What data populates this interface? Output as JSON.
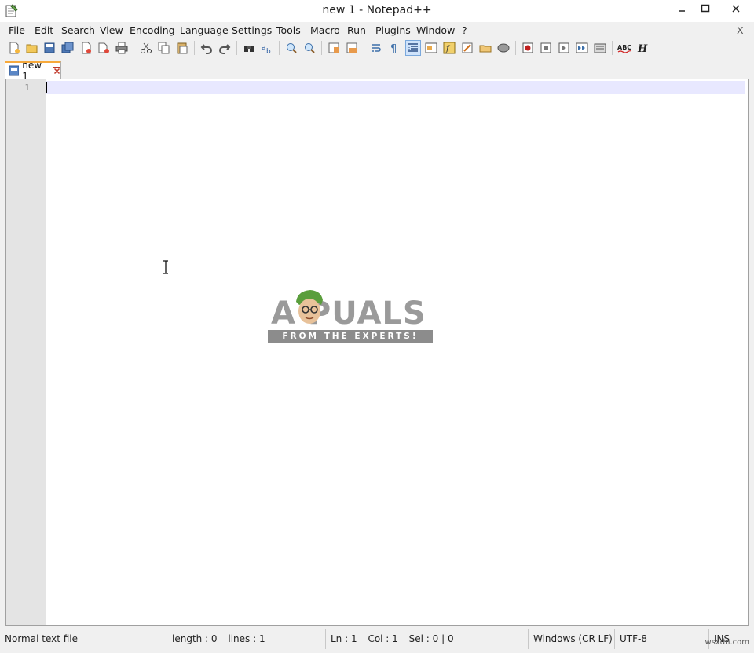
{
  "window": {
    "title": "new 1 - Notepad++"
  },
  "menu": {
    "items": [
      "File",
      "Edit",
      "Search",
      "View",
      "Encoding",
      "Language",
      "Settings",
      "Tools",
      "Macro",
      "Run",
      "Plugins",
      "Window",
      "?"
    ],
    "close_label": "X"
  },
  "toolbar": {
    "icons": [
      "new-file-icon",
      "open-file-icon",
      "save-icon",
      "save-all-icon",
      "close-icon",
      "close-all-icon",
      "print-icon",
      "cut-icon",
      "copy-icon",
      "paste-icon",
      "undo-icon",
      "redo-icon",
      "find-icon",
      "replace-icon",
      "zoom-in-icon",
      "zoom-out-icon",
      "sync-vertical-icon",
      "sync-horizontal-icon",
      "word-wrap-icon",
      "show-all-characters-icon",
      "indent-guide-icon",
      "document-map-icon",
      "function-list-icon",
      "folder-workspace-icon",
      "monitoring-icon",
      "macro-record-icon",
      "macro-stop-icon",
      "macro-play-icon",
      "macro-run-multiple-icon",
      "macro-save-icon",
      "spell-check-icon",
      "hex-icon"
    ],
    "active_icon": "indent-guide-icon",
    "spell_label": "ABC",
    "hex_label": "H"
  },
  "tabs": [
    {
      "label": "new 1",
      "active": true
    }
  ],
  "editor": {
    "line_numbers": [
      "1"
    ],
    "content": ""
  },
  "watermark": {
    "word": "A PUALS",
    "tagline": "FROM THE EXPERTS!"
  },
  "status": {
    "file_type": "Normal text file",
    "length": "length : 0",
    "lines": "lines : 1",
    "ln": "Ln : 1",
    "col": "Col : 1",
    "sel": "Sel : 0 | 0",
    "eol": "Windows (CR LF)",
    "encoding": "UTF-8",
    "mode": "INS"
  },
  "credit": "wsxdn.com",
  "colors": {
    "tab_accent": "#f7a93b",
    "current_line": "#e8e8ff",
    "gutter": "#e4e4e4"
  }
}
